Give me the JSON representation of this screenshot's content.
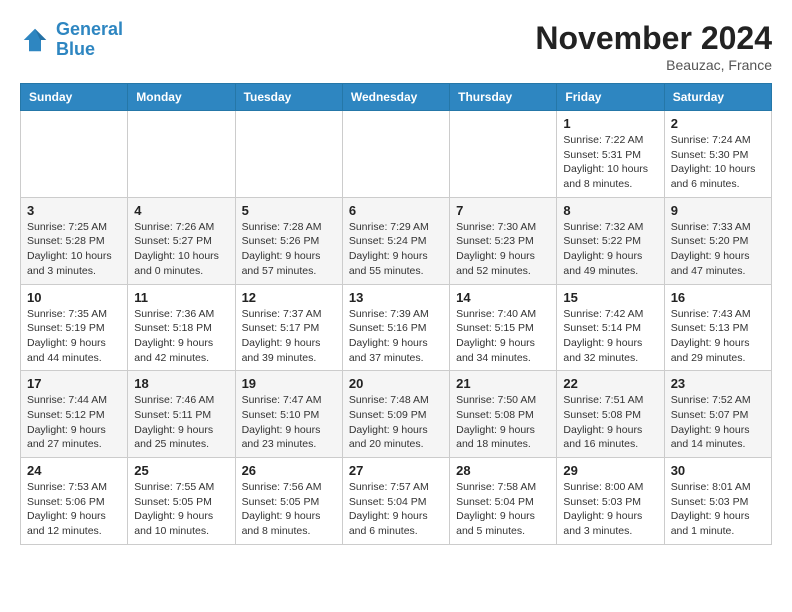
{
  "header": {
    "logo_line1": "General",
    "logo_line2": "Blue",
    "month_title": "November 2024",
    "location": "Beauzac, France"
  },
  "days_of_week": [
    "Sunday",
    "Monday",
    "Tuesday",
    "Wednesday",
    "Thursday",
    "Friday",
    "Saturday"
  ],
  "weeks": [
    [
      {
        "day": "",
        "info": ""
      },
      {
        "day": "",
        "info": ""
      },
      {
        "day": "",
        "info": ""
      },
      {
        "day": "",
        "info": ""
      },
      {
        "day": "",
        "info": ""
      },
      {
        "day": "1",
        "info": "Sunrise: 7:22 AM\nSunset: 5:31 PM\nDaylight: 10 hours and 8 minutes."
      },
      {
        "day": "2",
        "info": "Sunrise: 7:24 AM\nSunset: 5:30 PM\nDaylight: 10 hours and 6 minutes."
      }
    ],
    [
      {
        "day": "3",
        "info": "Sunrise: 7:25 AM\nSunset: 5:28 PM\nDaylight: 10 hours and 3 minutes."
      },
      {
        "day": "4",
        "info": "Sunrise: 7:26 AM\nSunset: 5:27 PM\nDaylight: 10 hours and 0 minutes."
      },
      {
        "day": "5",
        "info": "Sunrise: 7:28 AM\nSunset: 5:26 PM\nDaylight: 9 hours and 57 minutes."
      },
      {
        "day": "6",
        "info": "Sunrise: 7:29 AM\nSunset: 5:24 PM\nDaylight: 9 hours and 55 minutes."
      },
      {
        "day": "7",
        "info": "Sunrise: 7:30 AM\nSunset: 5:23 PM\nDaylight: 9 hours and 52 minutes."
      },
      {
        "day": "8",
        "info": "Sunrise: 7:32 AM\nSunset: 5:22 PM\nDaylight: 9 hours and 49 minutes."
      },
      {
        "day": "9",
        "info": "Sunrise: 7:33 AM\nSunset: 5:20 PM\nDaylight: 9 hours and 47 minutes."
      }
    ],
    [
      {
        "day": "10",
        "info": "Sunrise: 7:35 AM\nSunset: 5:19 PM\nDaylight: 9 hours and 44 minutes."
      },
      {
        "day": "11",
        "info": "Sunrise: 7:36 AM\nSunset: 5:18 PM\nDaylight: 9 hours and 42 minutes."
      },
      {
        "day": "12",
        "info": "Sunrise: 7:37 AM\nSunset: 5:17 PM\nDaylight: 9 hours and 39 minutes."
      },
      {
        "day": "13",
        "info": "Sunrise: 7:39 AM\nSunset: 5:16 PM\nDaylight: 9 hours and 37 minutes."
      },
      {
        "day": "14",
        "info": "Sunrise: 7:40 AM\nSunset: 5:15 PM\nDaylight: 9 hours and 34 minutes."
      },
      {
        "day": "15",
        "info": "Sunrise: 7:42 AM\nSunset: 5:14 PM\nDaylight: 9 hours and 32 minutes."
      },
      {
        "day": "16",
        "info": "Sunrise: 7:43 AM\nSunset: 5:13 PM\nDaylight: 9 hours and 29 minutes."
      }
    ],
    [
      {
        "day": "17",
        "info": "Sunrise: 7:44 AM\nSunset: 5:12 PM\nDaylight: 9 hours and 27 minutes."
      },
      {
        "day": "18",
        "info": "Sunrise: 7:46 AM\nSunset: 5:11 PM\nDaylight: 9 hours and 25 minutes."
      },
      {
        "day": "19",
        "info": "Sunrise: 7:47 AM\nSunset: 5:10 PM\nDaylight: 9 hours and 23 minutes."
      },
      {
        "day": "20",
        "info": "Sunrise: 7:48 AM\nSunset: 5:09 PM\nDaylight: 9 hours and 20 minutes."
      },
      {
        "day": "21",
        "info": "Sunrise: 7:50 AM\nSunset: 5:08 PM\nDaylight: 9 hours and 18 minutes."
      },
      {
        "day": "22",
        "info": "Sunrise: 7:51 AM\nSunset: 5:08 PM\nDaylight: 9 hours and 16 minutes."
      },
      {
        "day": "23",
        "info": "Sunrise: 7:52 AM\nSunset: 5:07 PM\nDaylight: 9 hours and 14 minutes."
      }
    ],
    [
      {
        "day": "24",
        "info": "Sunrise: 7:53 AM\nSunset: 5:06 PM\nDaylight: 9 hours and 12 minutes."
      },
      {
        "day": "25",
        "info": "Sunrise: 7:55 AM\nSunset: 5:05 PM\nDaylight: 9 hours and 10 minutes."
      },
      {
        "day": "26",
        "info": "Sunrise: 7:56 AM\nSunset: 5:05 PM\nDaylight: 9 hours and 8 minutes."
      },
      {
        "day": "27",
        "info": "Sunrise: 7:57 AM\nSunset: 5:04 PM\nDaylight: 9 hours and 6 minutes."
      },
      {
        "day": "28",
        "info": "Sunrise: 7:58 AM\nSunset: 5:04 PM\nDaylight: 9 hours and 5 minutes."
      },
      {
        "day": "29",
        "info": "Sunrise: 8:00 AM\nSunset: 5:03 PM\nDaylight: 9 hours and 3 minutes."
      },
      {
        "day": "30",
        "info": "Sunrise: 8:01 AM\nSunset: 5:03 PM\nDaylight: 9 hours and 1 minute."
      }
    ]
  ]
}
